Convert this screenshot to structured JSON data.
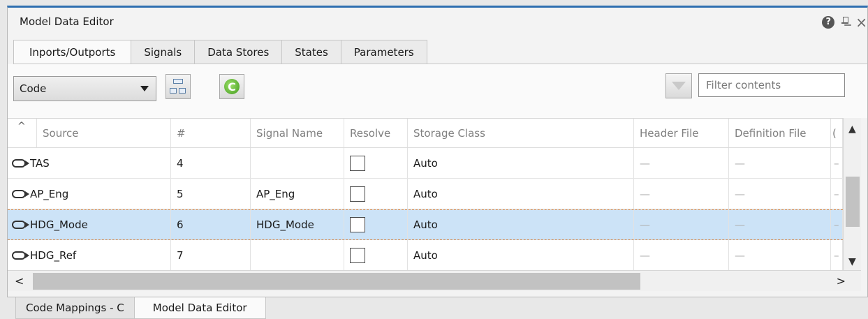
{
  "window": {
    "title": "Model Data Editor"
  },
  "tabs": [
    {
      "label": "Inports/Outports",
      "active": true
    },
    {
      "label": "Signals",
      "active": false
    },
    {
      "label": "Data Stores",
      "active": false
    },
    {
      "label": "States",
      "active": false
    },
    {
      "label": "Parameters",
      "active": false
    }
  ],
  "toolbar": {
    "view_select": "Code",
    "filter_placeholder": "Filter contents"
  },
  "table": {
    "columns": [
      "Source",
      "#",
      "Signal Name",
      "Resolve",
      "Storage Class",
      "Header File",
      "Definition File",
      "("
    ],
    "rows": [
      {
        "source": "TAS",
        "num": "4",
        "signal_name": "",
        "resolve": false,
        "storage_class": "Auto",
        "header_file": "—",
        "definition_file": "—",
        "extra": "–",
        "selected": false
      },
      {
        "source": "AP_Eng",
        "num": "5",
        "signal_name": "AP_Eng",
        "resolve": false,
        "storage_class": "Auto",
        "header_file": "—",
        "definition_file": "—",
        "extra": "–",
        "selected": false
      },
      {
        "source": "HDG_Mode",
        "num": "6",
        "signal_name": "HDG_Mode",
        "resolve": false,
        "storage_class": "Auto",
        "header_file": "—",
        "definition_file": "—",
        "extra": "–",
        "selected": true
      },
      {
        "source": "HDG_Ref",
        "num": "7",
        "signal_name": "",
        "resolve": false,
        "storage_class": "Auto",
        "header_file": "—",
        "definition_file": "—",
        "extra": "–",
        "selected": false
      }
    ]
  },
  "bottom_tabs": [
    {
      "label": "Code Mappings - C",
      "active": false
    },
    {
      "label": "Model Data Editor",
      "active": true
    }
  ],
  "colors": {
    "accent": "#2f6fb0",
    "selection": "#cce3f7"
  }
}
